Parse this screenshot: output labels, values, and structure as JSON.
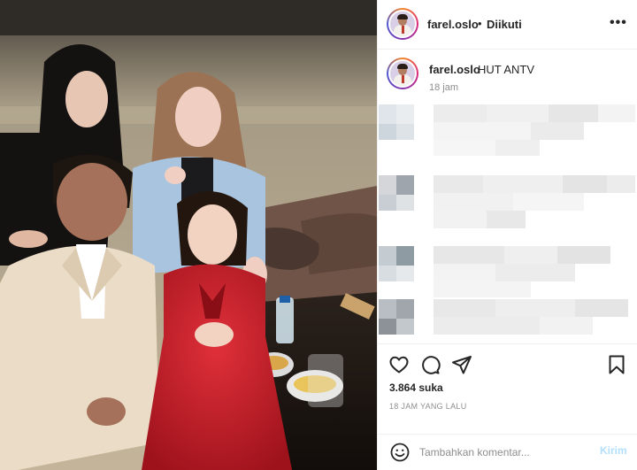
{
  "post": {
    "username": "farel.oslo",
    "separator": "•",
    "follow_status": "Diikuti",
    "more_icon": "more-options-icon"
  },
  "caption": {
    "username": "farel.oslo",
    "text": "HUT ANTV",
    "time": "18 jam"
  },
  "actions": {
    "like_icon": "heart-icon",
    "comment_icon": "comment-icon",
    "share_icon": "share-icon",
    "save_icon": "bookmark-icon",
    "likes_text": "3.864 suka",
    "posted_ago": "18 JAM YANG LALU"
  },
  "comment_box": {
    "placeholder": "Tambahkan komentar...",
    "post_label": "Kirim"
  },
  "colors": {
    "text": "#262626",
    "muted": "#8e8e8e",
    "border": "#efefef",
    "post_disabled": "#b2dffc",
    "dress": "#c81d25",
    "suit": "#eadcc6"
  }
}
